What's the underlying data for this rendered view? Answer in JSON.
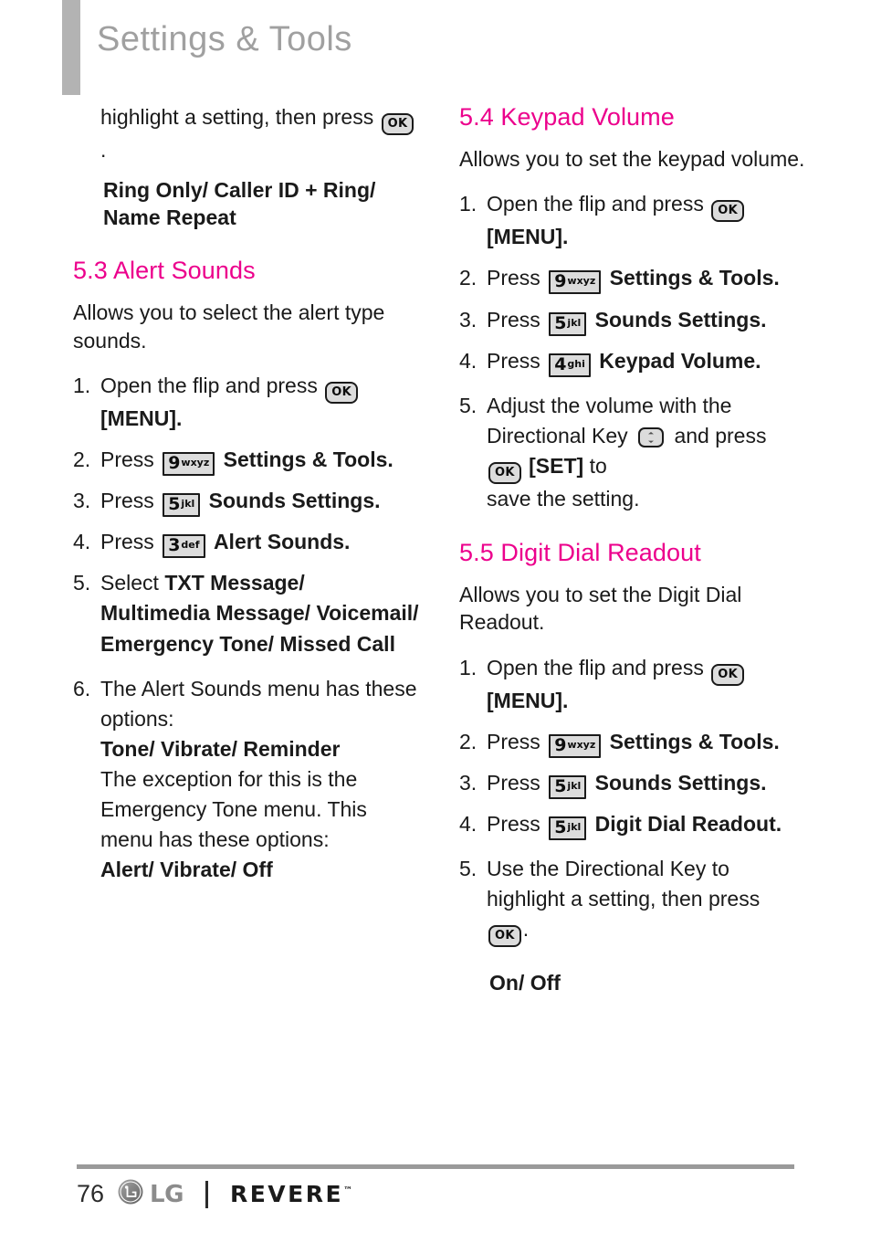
{
  "header": {
    "title": "Settings & Tools",
    "accent_color": "#ec008c",
    "title_color": "#a0a0a0",
    "bar_color": "#b3b3b3"
  },
  "left_column": {
    "continued_step": {
      "text_before": "highlight a setting, then press",
      "icon": "ok-key-icon",
      "text_after": "."
    },
    "continued_options": "Ring Only/ Caller ID + Ring/ Name Repeat",
    "section": {
      "heading": "5.3 Alert Sounds",
      "intro": "Allows you to select the alert type sounds.",
      "steps": [
        {
          "num": "1.",
          "before": "Open the flip and press",
          "icon": "ok-key-icon",
          "after": "[MENU]."
        },
        {
          "num": "2.",
          "before": "Press",
          "key_digit": "9",
          "key_letters": "wxyz",
          "after": "Settings & Tools."
        },
        {
          "num": "3.",
          "before": "Press",
          "key_digit": "5",
          "key_letters": "jkl",
          "after": "Sounds Settings."
        },
        {
          "num": "4.",
          "before": "Press",
          "key_digit": "3",
          "key_letters": "def",
          "after": "Alert Sounds."
        },
        {
          "num": "5.",
          "before": "Select",
          "bold_options": "TXT Message/ Multimedia Message/ Voicemail/ Emergency Tone/ Missed Call"
        },
        {
          "num": "6.",
          "before": "The Alert Sounds menu has these options:",
          "bold_options": "Tone/ Vibrate/ Reminder",
          "note": "The exception for this is the Emergency Tone menu. This menu has these options:",
          "note_options": "Alert/ Vibrate/ Off"
        }
      ]
    }
  },
  "right_column": {
    "sections": [
      {
        "heading": "5.4 Keypad Volume",
        "intro": "Allows you to set the keypad volume.",
        "steps": [
          {
            "num": "1.",
            "before": "Open the flip and press",
            "icon": "ok-key-icon",
            "after": "[MENU]."
          },
          {
            "num": "2.",
            "before": "Press",
            "key_digit": "9",
            "key_letters": "wxyz",
            "after": "Settings & Tools."
          },
          {
            "num": "3.",
            "before": "Press",
            "key_digit": "5",
            "key_letters": "jkl",
            "after": "Sounds Settings."
          },
          {
            "num": "4.",
            "before": "Press",
            "key_digit": "4",
            "key_letters": "ghi",
            "after": "Keypad Volume."
          },
          {
            "num": "5.",
            "line1": "Adjust the volume with the",
            "line2a": "Directional Key",
            "dir_icon": "directional-key-icon",
            "line2b": "and press",
            "ok_icon": "ok-key-icon",
            "set_label": "[SET]",
            "line3a": "to",
            "line4": "save the setting."
          }
        ]
      },
      {
        "heading": "5.5 Digit Dial Readout",
        "intro": "Allows you to set the Digit Dial Readout.",
        "steps": [
          {
            "num": "1.",
            "before": "Open the flip and press",
            "icon": "ok-key-icon",
            "after": "[MENU]."
          },
          {
            "num": "2.",
            "before": "Press",
            "key_digit": "9",
            "key_letters": "wxyz",
            "after": "Settings & Tools."
          },
          {
            "num": "3.",
            "before": "Press",
            "key_digit": "5",
            "key_letters": "jkl",
            "after": "Sounds Settings."
          },
          {
            "num": "4.",
            "before": "Press",
            "key_digit": "5",
            "key_letters": "jkl",
            "after": "Digit Dial Readout."
          },
          {
            "num": "5.",
            "line1": "Use the Directional Key to",
            "line2": "highlight a setting, then press",
            "icon": "ok-key-icon",
            "after": "."
          }
        ],
        "options": "On/ Off"
      }
    ]
  },
  "footer": {
    "page_number": "76",
    "brand": "LG",
    "model": "REVERE",
    "trademark": "™"
  }
}
